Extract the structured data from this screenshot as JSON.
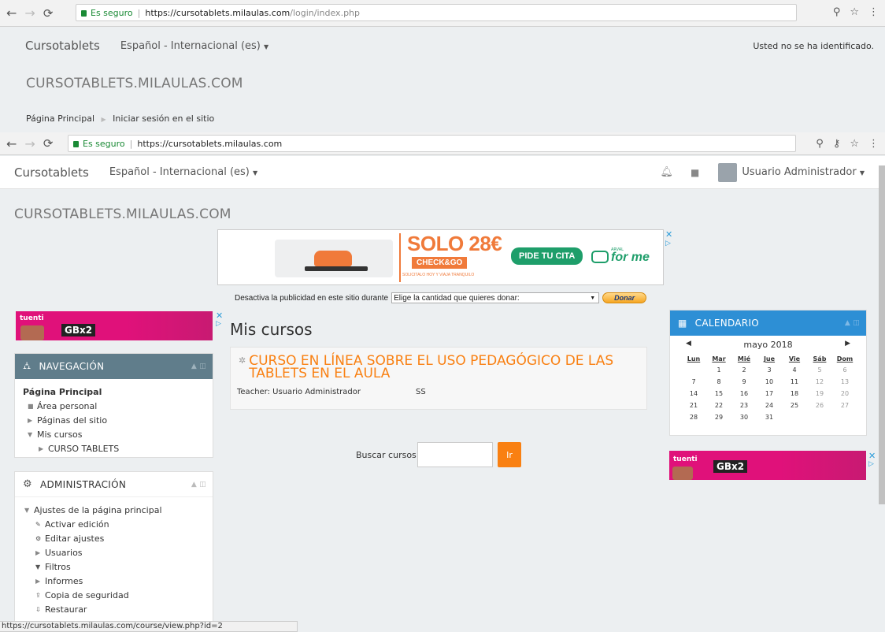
{
  "browser_back": {
    "url_secure": "Es seguro",
    "url_host": "https://cursotablets.milaulas.com",
    "url_path": "/login/index.php"
  },
  "moodle_back": {
    "brand": "Cursotablets",
    "language": "Español - Internacional (es)",
    "login_status": "Usted no se ha identificado.",
    "site_title": "CURSOTABLETS.MILAULAS.COM",
    "breadcrumb_home": "Página Principal",
    "breadcrumb_current": "Iniciar sesión en el sitio"
  },
  "browser_front": {
    "url_secure": "Es seguro",
    "url_host": "https://cursotablets.milaulas.com"
  },
  "moodle": {
    "brand": "Cursotablets",
    "language": "Español - Internacional (es)",
    "user_name": "Usuario Administrador",
    "site_title": "CURSOTABLETS.MILAULAS.COM"
  },
  "ad": {
    "promo_price": "SOLO 28€",
    "promo_name": "CHECK&GO",
    "promo_sub": "SOLICITALO HOY Y VIAJA TRANQUILO",
    "cta": "PIDE TU CITA",
    "brand_small": "ARVAL",
    "brand_main": "for me",
    "donate_text": "Desactiva la publicidad en este sitio durante",
    "donate_select": "Elige la cantidad que quieres donar:",
    "donate_button": "Donar",
    "tuenti": "tuenti",
    "gb": "GBx2"
  },
  "navigation": {
    "title": "NAVEGACIÓN",
    "home": "Página Principal",
    "items": [
      "Área personal",
      "Páginas del sitio",
      "Mis cursos",
      "CURSO TABLETS"
    ]
  },
  "administration": {
    "title": "ADMINISTRACIÓN",
    "group": "Ajustes de la página principal",
    "items": [
      "Activar edición",
      "Editar ajustes",
      "Usuarios",
      "Filtros",
      "Informes",
      "Copia de seguridad",
      "Restaurar"
    ]
  },
  "main": {
    "heading": "Mis cursos",
    "course_title": "CURSO EN LÍNEA SOBRE EL USO PEDAGÓGICO DE LAS TABLETS EN EL AULA",
    "teacher": "Teacher: Usuario Administrador",
    "teacher_extra": "SS",
    "search_label": "Buscar cursos:",
    "search_button": "Ir"
  },
  "calendar": {
    "title": "CALENDARIO",
    "month": "mayo 2018",
    "days": [
      "Lun",
      "Mar",
      "Mié",
      "Jue",
      "Vie",
      "Sáb",
      "Dom"
    ],
    "weeks": [
      [
        "",
        "1",
        "2",
        "3",
        "4",
        "5",
        "6"
      ],
      [
        "7",
        "8",
        "9",
        "10",
        "11",
        "12",
        "13"
      ],
      [
        "14",
        "15",
        "16",
        "17",
        "18",
        "19",
        "20"
      ],
      [
        "21",
        "22",
        "23",
        "24",
        "25",
        "26",
        "27"
      ],
      [
        "28",
        "29",
        "30",
        "31",
        "",
        "",
        ""
      ]
    ]
  },
  "status_bar": "https://cursotablets.milaulas.com/course/view.php?id=2",
  "colors": {
    "accent": "#f98012",
    "calendar_header": "#2d8fd5",
    "nav_header": "#607d8b",
    "ad_pink": "#e0117a"
  }
}
